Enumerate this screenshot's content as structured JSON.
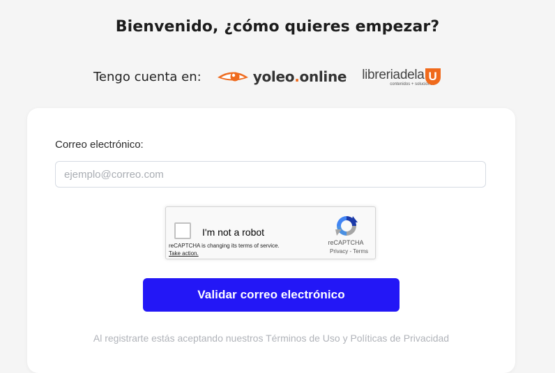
{
  "header": {
    "title": "Bienvenido, ¿cómo quieres empezar?"
  },
  "account": {
    "label": "Tengo cuenta en:",
    "yoleo": {
      "name_main": "yoleo",
      "name_dot": ".",
      "name_tld": "online",
      "icon": "eye-logo-icon"
    },
    "libreria": {
      "name": "libreriadela",
      "letter": "U",
      "tagline": "contenidos + soluciones"
    }
  },
  "form": {
    "email_label": "Correo electrónico:",
    "email_placeholder": "ejemplo@correo.com",
    "email_value": "",
    "recaptcha": {
      "label": "I'm not a robot",
      "notice": "reCAPTCHA is changing its terms of service.",
      "take_action": "Take action.",
      "brand": "reCAPTCHA",
      "privacy": "Privacy",
      "separator": " - ",
      "terms": "Terms"
    },
    "submit_label": "Validar correo electrónico",
    "terms_prefix": "Al registrarte estás aceptando nuestros ",
    "terms_link": "Términos de Uso",
    "terms_and": " y ",
    "privacy_link": "Políticas de Privacidad"
  },
  "colors": {
    "accent": "#2317f6",
    "brand_orange": "#ef6b1e",
    "background": "#f5f5f5"
  }
}
